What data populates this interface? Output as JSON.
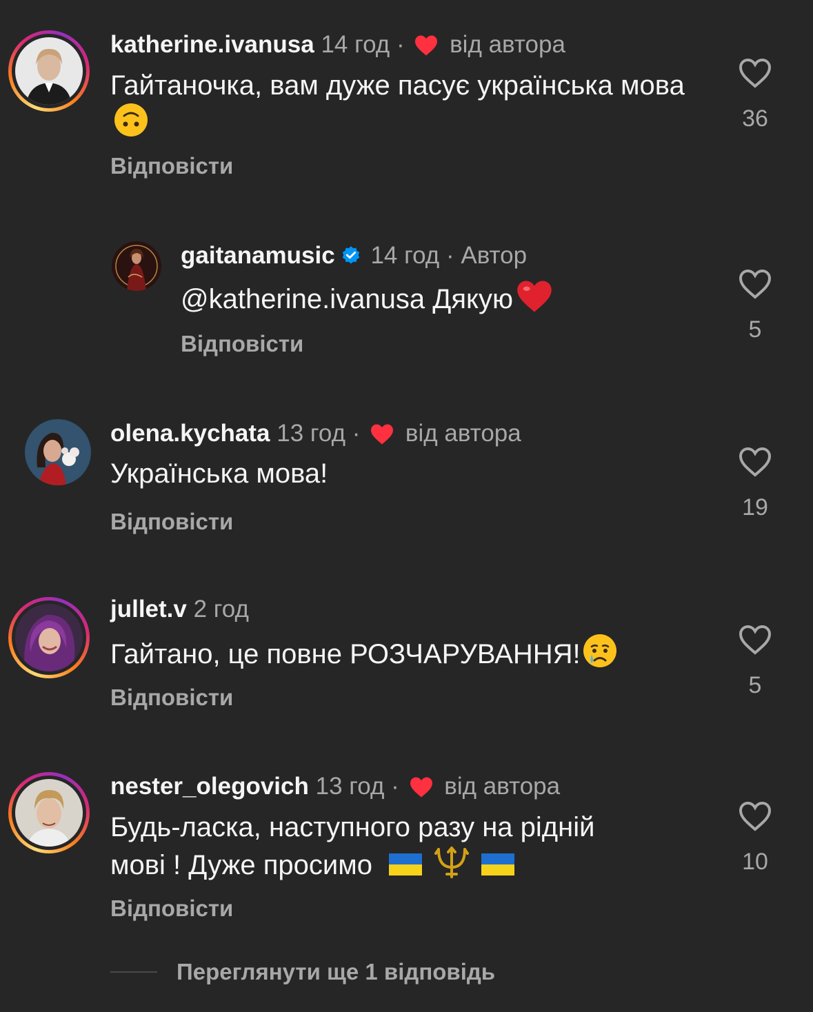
{
  "comments": [
    {
      "username": "katherine.ivanusa",
      "time": "14 год",
      "liked_by_author": "від автора",
      "text": "Гайтаночка, вам дуже пасує українська мова",
      "likes": "36",
      "reply": "Відповісти"
    },
    {
      "username": "gaitanamusic",
      "time": "14 год",
      "author_label": "Автор",
      "text": "@katherine.ivanusa Дякую",
      "likes": "5",
      "reply": "Відповісти"
    },
    {
      "username": "olena.kychata",
      "time": "13 год",
      "liked_by_author": "від автора",
      "text": "Українська мова!",
      "likes": "19",
      "reply": "Відповісти"
    },
    {
      "username": "jullet.v",
      "time": "2 год",
      "text": "Гайтано, це повне РОЗЧАРУВАННЯ!",
      "likes": "5",
      "reply": "Відповісти"
    },
    {
      "username": "nester_olegovich",
      "time": "13 год",
      "liked_by_author": "від автора",
      "text_line1": "Будь-ласка, наступного разу на рідній",
      "text_line2": "мові ! Дуже просимо",
      "likes": "10",
      "reply": "Відповісти"
    }
  ],
  "more_replies": "Переглянути ще 1 відповідь",
  "colors": {
    "background": "#262626",
    "primary_text": "#f5f5f5",
    "secondary_text": "#a8a8a8",
    "heart_red": "#ff3040",
    "verified_blue": "#0095f6"
  },
  "icons": {
    "like": "heart-outline-icon",
    "liked_by_author": "heart-filled-icon",
    "verified": "verified-badge-icon"
  }
}
